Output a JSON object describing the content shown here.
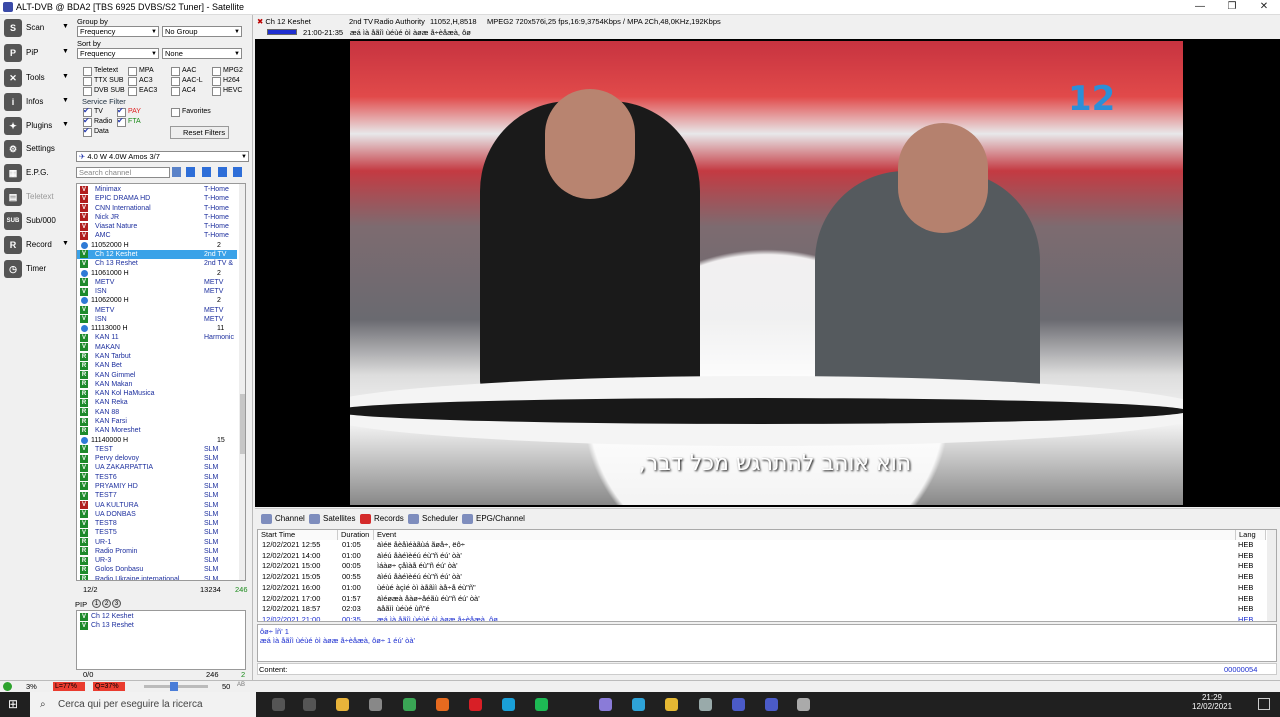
{
  "window": {
    "title": "ALT-DVB @ BDA2 [TBS 6925 DVBS/S2 Tuner] - Satellite",
    "minimize": "—",
    "maximize": "❐",
    "close": "✕"
  },
  "sidebar": [
    {
      "label": "Scan",
      "icon": "scan-icon",
      "glyph": "S"
    },
    {
      "label": "PiP",
      "icon": "pip-icon",
      "glyph": "P"
    },
    {
      "label": "Tools",
      "icon": "tools-icon",
      "glyph": "✕"
    },
    {
      "label": "Infos",
      "icon": "info-icon",
      "glyph": "i"
    },
    {
      "label": "Plugins",
      "icon": "plugins-icon",
      "glyph": "✦"
    },
    {
      "label": "Settings",
      "icon": "settings-icon",
      "glyph": "⚙"
    },
    {
      "label": "E.P.G.",
      "icon": "epg-icon",
      "glyph": "▦"
    },
    {
      "label": "Teletext",
      "icon": "teletext-icon",
      "glyph": "▤"
    },
    {
      "label": "Sub/000",
      "icon": "subtitle-icon",
      "glyph": "SUB"
    },
    {
      "label": "Record",
      "icon": "record-icon",
      "glyph": "R"
    },
    {
      "label": "Timer",
      "icon": "timer-icon",
      "glyph": "◷"
    }
  ],
  "filters": {
    "group_by_label": "Group by",
    "group_by": "Frequency",
    "group_opt": "No Group",
    "sort_by_label": "Sort by",
    "sort_by": "Frequency",
    "sort_opt": "None",
    "codecs": [
      "Teletext",
      "MPA",
      "AAC",
      "MPG2",
      "TTX SUB",
      "AC3",
      "AAC-L",
      "H264",
      "DVB SUB",
      "EAC3",
      "AC4",
      "HEVC"
    ],
    "service_filter_label": "Service Filter",
    "tv": "TV",
    "pay": "PAY",
    "radio": "Radio",
    "fta": "FTA",
    "data": "Data",
    "favorites": "Favorites",
    "reset": "Reset Filters"
  },
  "satellite": "4.0 W 4.0W Amos 3/7",
  "search_placeholder": "Search channel",
  "channels": [
    {
      "t": "V",
      "c": "#b01d1d",
      "name": "Minimax",
      "prov": "T-Home"
    },
    {
      "t": "V",
      "c": "#b01d1d",
      "name": "EPIC DRAMA HD",
      "prov": "T-Home"
    },
    {
      "t": "V",
      "c": "#b01d1d",
      "name": "CNN International",
      "prov": "T-Home"
    },
    {
      "t": "V",
      "c": "#b01d1d",
      "name": "Nick JR",
      "prov": "T-Home"
    },
    {
      "t": "V",
      "c": "#b01d1d",
      "name": "Viasat Nature",
      "prov": "T-Home"
    },
    {
      "t": "V",
      "c": "#b01d1d",
      "name": "AMC",
      "prov": "T-Home"
    },
    {
      "tp": true,
      "name": "11052000  H",
      "prov": "2"
    },
    {
      "t": "V",
      "c": "#1d8a2b",
      "name": "Ch 12 Keshet",
      "prov": "2nd TV",
      "sel": true
    },
    {
      "t": "V",
      "c": "#1d8a2b",
      "name": "Ch 13 Reshet",
      "prov": "2nd TV &"
    },
    {
      "tp": true,
      "name": "11061000  H",
      "prov": "2"
    },
    {
      "t": "V",
      "c": "#1d8a2b",
      "name": "METV",
      "prov": "METV"
    },
    {
      "t": "V",
      "c": "#1d8a2b",
      "name": "ISN",
      "prov": "METV"
    },
    {
      "tp": true,
      "name": "11062000  H",
      "prov": "2"
    },
    {
      "t": "V",
      "c": "#1d8a2b",
      "name": "METV",
      "prov": "METV"
    },
    {
      "t": "V",
      "c": "#1d8a2b",
      "name": "ISN",
      "prov": "METV"
    },
    {
      "tp": true,
      "name": "11113000  H",
      "prov": "11"
    },
    {
      "t": "V",
      "c": "#1d8a2b",
      "name": "KAN 11",
      "prov": "Harmonic"
    },
    {
      "t": "V",
      "c": "#1d8a2b",
      "name": "MAKAN",
      "prov": ""
    },
    {
      "t": "R",
      "c": "#1d8a2b",
      "name": "KAN Tarbut",
      "prov": ""
    },
    {
      "t": "R",
      "c": "#1d8a2b",
      "name": "KAN Bet",
      "prov": ""
    },
    {
      "t": "R",
      "c": "#1d8a2b",
      "name": "KAN Gimmel",
      "prov": ""
    },
    {
      "t": "R",
      "c": "#1d8a2b",
      "name": "KAN Makan",
      "prov": ""
    },
    {
      "t": "R",
      "c": "#1d8a2b",
      "name": "KAN Kol HaMusica",
      "prov": ""
    },
    {
      "t": "R",
      "c": "#1d8a2b",
      "name": "KAN Reka",
      "prov": ""
    },
    {
      "t": "R",
      "c": "#1d8a2b",
      "name": "KAN 88",
      "prov": ""
    },
    {
      "t": "R",
      "c": "#1d8a2b",
      "name": "KAN Farsi",
      "prov": ""
    },
    {
      "t": "R",
      "c": "#1d8a2b",
      "name": "KAN Moreshet",
      "prov": ""
    },
    {
      "tp": true,
      "name": "11140000  H",
      "prov": "15"
    },
    {
      "t": "V",
      "c": "#1d8a2b",
      "name": "TEST",
      "prov": "SLM"
    },
    {
      "t": "V",
      "c": "#1d8a2b",
      "name": "Pervy delovoy",
      "prov": "SLM"
    },
    {
      "t": "V",
      "c": "#1d8a2b",
      "name": "UA ZAKARPATTIA",
      "prov": "SLM"
    },
    {
      "t": "V",
      "c": "#1d8a2b",
      "name": "TEST6",
      "prov": "SLM"
    },
    {
      "t": "V",
      "c": "#1d8a2b",
      "name": "PRYAMIY HD",
      "prov": "SLM"
    },
    {
      "t": "V",
      "c": "#1d8a2b",
      "name": "TEST7",
      "prov": "SLM"
    },
    {
      "t": "V",
      "c": "#b01d1d",
      "name": "UA KULTURA",
      "prov": "SLM"
    },
    {
      "t": "V",
      "c": "#1d8a2b",
      "name": "UA DONBAS",
      "prov": "SLM"
    },
    {
      "t": "V",
      "c": "#1d8a2b",
      "name": "TEST8",
      "prov": "SLM"
    },
    {
      "t": "V",
      "c": "#1d8a2b",
      "name": "TEST5",
      "prov": "SLM"
    },
    {
      "t": "R",
      "c": "#1d8a2b",
      "name": "UR-1",
      "prov": "SLM"
    },
    {
      "t": "R",
      "c": "#1d8a2b",
      "name": "Radio Promin",
      "prov": "SLM"
    },
    {
      "t": "R",
      "c": "#1d8a2b",
      "name": "UR-3",
      "prov": "SLM"
    },
    {
      "t": "R",
      "c": "#1d8a2b",
      "name": "Golos Donbasu",
      "prov": "SLM"
    },
    {
      "t": "R",
      "c": "#1d8a2b",
      "name": "Radio Ukraine international",
      "prov": "SLM"
    }
  ],
  "list_footer": {
    "pos": "12/2",
    "count": "13234",
    "extra": "246"
  },
  "pip": {
    "label": "PIP",
    "buttons": [
      "1",
      "2",
      "3"
    ],
    "channels": [
      "Ch 12 Keshet",
      "Ch 13 Reshet"
    ],
    "footer_left": "0/0",
    "footer_mid": "246",
    "footer_right": "2"
  },
  "info_bar": {
    "channel": "Ch 12 Keshet",
    "provider": "2nd TV",
    "authority": "Radio Authority",
    "freq": "11052,H,8518",
    "stream": "MPEG2 720x576i,25 fps,16:9,3754Kbps / MPA 2Ch,48,0KHz,192Kbps",
    "time": "21:00-21:35",
    "event": "æá ìà åãîì ùéùé òì àøæ å÷èåæà, ôø"
  },
  "video": {
    "logo": "12",
    "subtitle": "הוא אוהב להתרגש מכל דבר,"
  },
  "tabs": [
    {
      "label": "Channel",
      "icon": "channel-icon"
    },
    {
      "label": "Satellites",
      "icon": "satellite-icon"
    },
    {
      "label": "Records",
      "icon": "records-icon"
    },
    {
      "label": "Scheduler",
      "icon": "scheduler-icon"
    },
    {
      "label": "EPG/Channel",
      "icon": "epg-channel-icon"
    }
  ],
  "epg": {
    "headers": [
      "Start Time",
      "Duration",
      "Event",
      "Lang"
    ],
    "rows": [
      {
        "start": "12/02/2021 12:55",
        "dur": "01:05",
        "event": "äìéë åèåìéàãùá ãøå÷, ëô÷",
        "lang": "HEB"
      },
      {
        "start": "12/02/2021 14:00",
        "dur": "01:00",
        "event": "äìéú åàéìèéú   éù\"ñ éú' òà'",
        "lang": "HEB"
      },
      {
        "start": "12/02/2021 15:00",
        "dur": "00:05",
        "event": "ìáàø÷ çåìàå   éù\"ñ éú' òà'",
        "lang": "HEB"
      },
      {
        "start": "12/02/2021 15:05",
        "dur": "00:55",
        "event": "äìéú åàéìèéú   éù\"ñ éú' òà'",
        "lang": "HEB"
      },
      {
        "start": "12/02/2021 16:00",
        "dur": "01:00",
        "event": "ùéùé àçìé òì àåãìì àå÷å   éù\"ñ\"",
        "lang": "HEB"
      },
      {
        "start": "12/02/2021 17:00",
        "dur": "01:57",
        "event": "äìéøæà åàø÷åéãù   éù\"ñ éú' òà'",
        "lang": "HEB"
      },
      {
        "start": "12/02/2021 18:57",
        "dur": "02:03",
        "event": "äåãìì ùéùé  ùñ\"é",
        "lang": "HEB"
      },
      {
        "start": "12/02/2021 21:00",
        "dur": "00:35",
        "event": "æá ìà åãîì ùéùé òì àøæ å÷èåæà, ôø",
        "lang": "HEB",
        "current": true
      }
    ]
  },
  "description": {
    "title": "ôø÷ îñ' 1",
    "text": "æá ìà åãîì ùéùé òì àøæ å÷èåæà, ôø÷ 1  éú' òà'"
  },
  "content": {
    "label": "Content:",
    "code": "00000054"
  },
  "status": {
    "signal": "3%",
    "level": "L=77%",
    "quality": "Q=37%",
    "volume": "50",
    "volume_label": "AB"
  },
  "taskbar": {
    "search": "Cerca qui per eseguire la ricerca",
    "time": "21:29",
    "date": "12/02/2021"
  }
}
